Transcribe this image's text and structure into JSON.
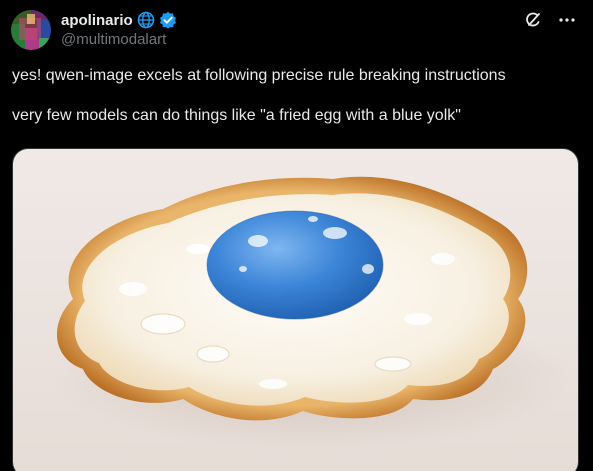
{
  "author": {
    "display_name": "apolinario",
    "handle": "@multimodalart",
    "badges": [
      "globe-icon",
      "verified-badge-icon"
    ]
  },
  "actions": {
    "grok_icon": "grok-icon",
    "more_icon": "more-dots-icon"
  },
  "tweet": {
    "paragraphs": [
      "yes! qwen-image excels at following precise rule breaking instructions",
      "very few models can do things like \"a fried egg with a blue yolk\""
    ]
  },
  "media": {
    "alt_description_hidden": "",
    "colors": {
      "background": "#ebe3df",
      "egg_white": "#fbf7ef",
      "crispy_edge": "#d99a3d",
      "yolk": "#3d86d8"
    }
  },
  "theme": {
    "background": "#000000",
    "text_primary": "#e7e9ea",
    "text_secondary": "#71767b",
    "verified_blue": "#1d9bf0"
  }
}
